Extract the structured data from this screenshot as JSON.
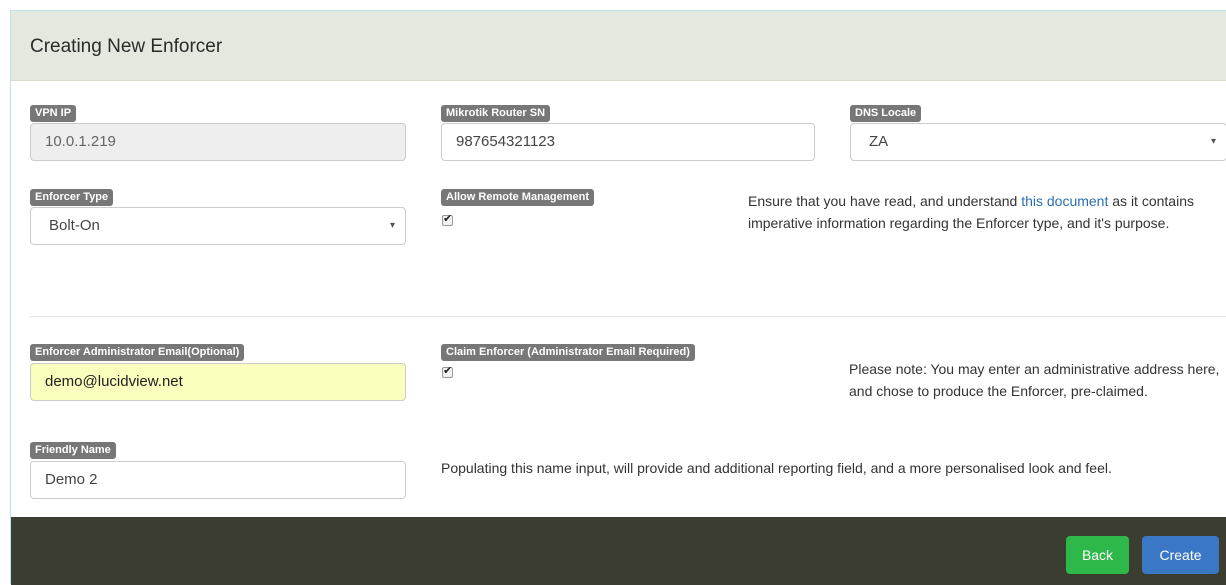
{
  "panel": {
    "title": "Creating New Enforcer"
  },
  "fields": {
    "vpn_ip": {
      "label": "VPN IP",
      "value": "10.0.1.219"
    },
    "router_sn": {
      "label": "Mikrotik Router SN",
      "value": "987654321123"
    },
    "dns_locale": {
      "label": "DNS Locale",
      "value": "ZA"
    },
    "enforcer_type": {
      "label": "Enforcer Type",
      "value": "Bolt-On"
    },
    "remote_mgmt": {
      "label": "Allow Remote Management",
      "checked": true
    },
    "admin_email": {
      "label": "Enforcer Administrator Email(Optional)",
      "value": "demo@lucidview.net"
    },
    "claim": {
      "label": "Claim Enforcer (Administrator Email Required)",
      "checked": true
    },
    "friendly_name": {
      "label": "Friendly Name",
      "value": "Demo 2"
    }
  },
  "notes": {
    "type_pre": "Ensure that you have read, and understand ",
    "type_link": "this document",
    "type_post": " as it contains imperative information regarding the Enforcer type, and it's purpose.",
    "claim": "Please note: You may enter an administrative address here, and chose to produce the Enforcer, pre-claimed.",
    "friendly": "Populating this name input, will provide and additional reporting field, and a more personalised look and feel."
  },
  "footer": {
    "back_label": "Back",
    "create_label": "Create"
  },
  "icons": {
    "caret": "▾",
    "check": "✔"
  },
  "colors": {
    "heading_bg": "#e3e9de",
    "footer_bg": "#3a3d30",
    "back": "#2eb84a",
    "create": "#3a77c4",
    "label_bg": "#777777"
  }
}
